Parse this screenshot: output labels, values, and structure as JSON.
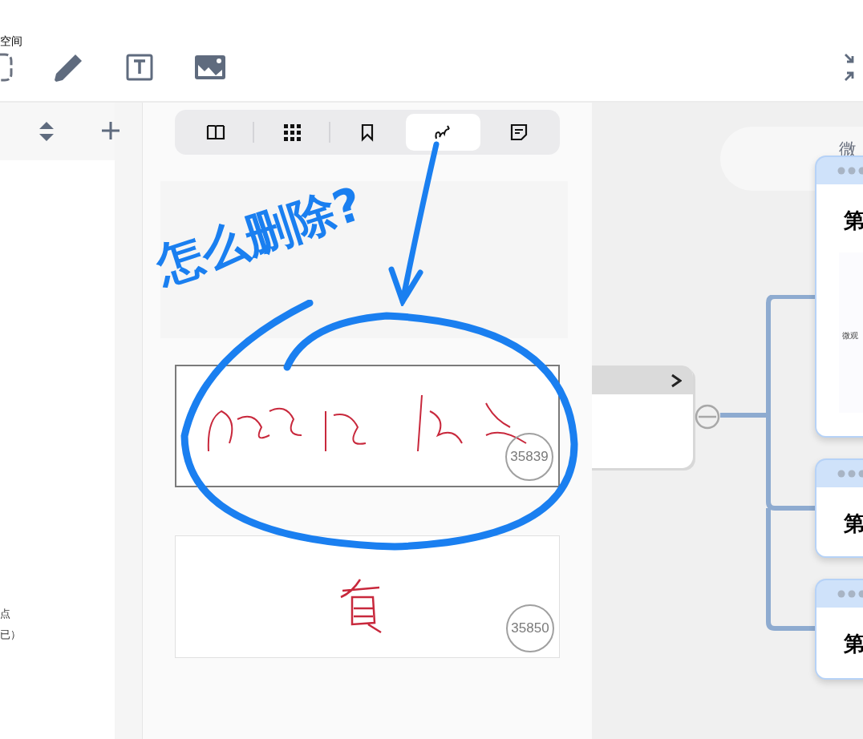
{
  "toolbar": {
    "label": "空间"
  },
  "sidebar": {
    "lines": [
      "点",
      "已）"
    ]
  },
  "reader_tabs": [
    {
      "kind": "book",
      "selected": false
    },
    {
      "kind": "grid",
      "selected": false
    },
    {
      "kind": "bookmark",
      "selected": false
    },
    {
      "kind": "ink",
      "selected": true
    },
    {
      "kind": "note",
      "selected": false
    }
  ],
  "pages": [
    {
      "number": "35839",
      "selected": true
    },
    {
      "number": "35850",
      "selected": false
    }
  ],
  "annotation": {
    "text": "怎么删除?"
  },
  "mindmap": {
    "bubble": "微",
    "node": {
      "expanded": true
    },
    "cards": [
      {
        "title": "第",
        "caption": "微观"
      },
      {
        "title": "第"
      },
      {
        "title": "第"
      }
    ]
  }
}
